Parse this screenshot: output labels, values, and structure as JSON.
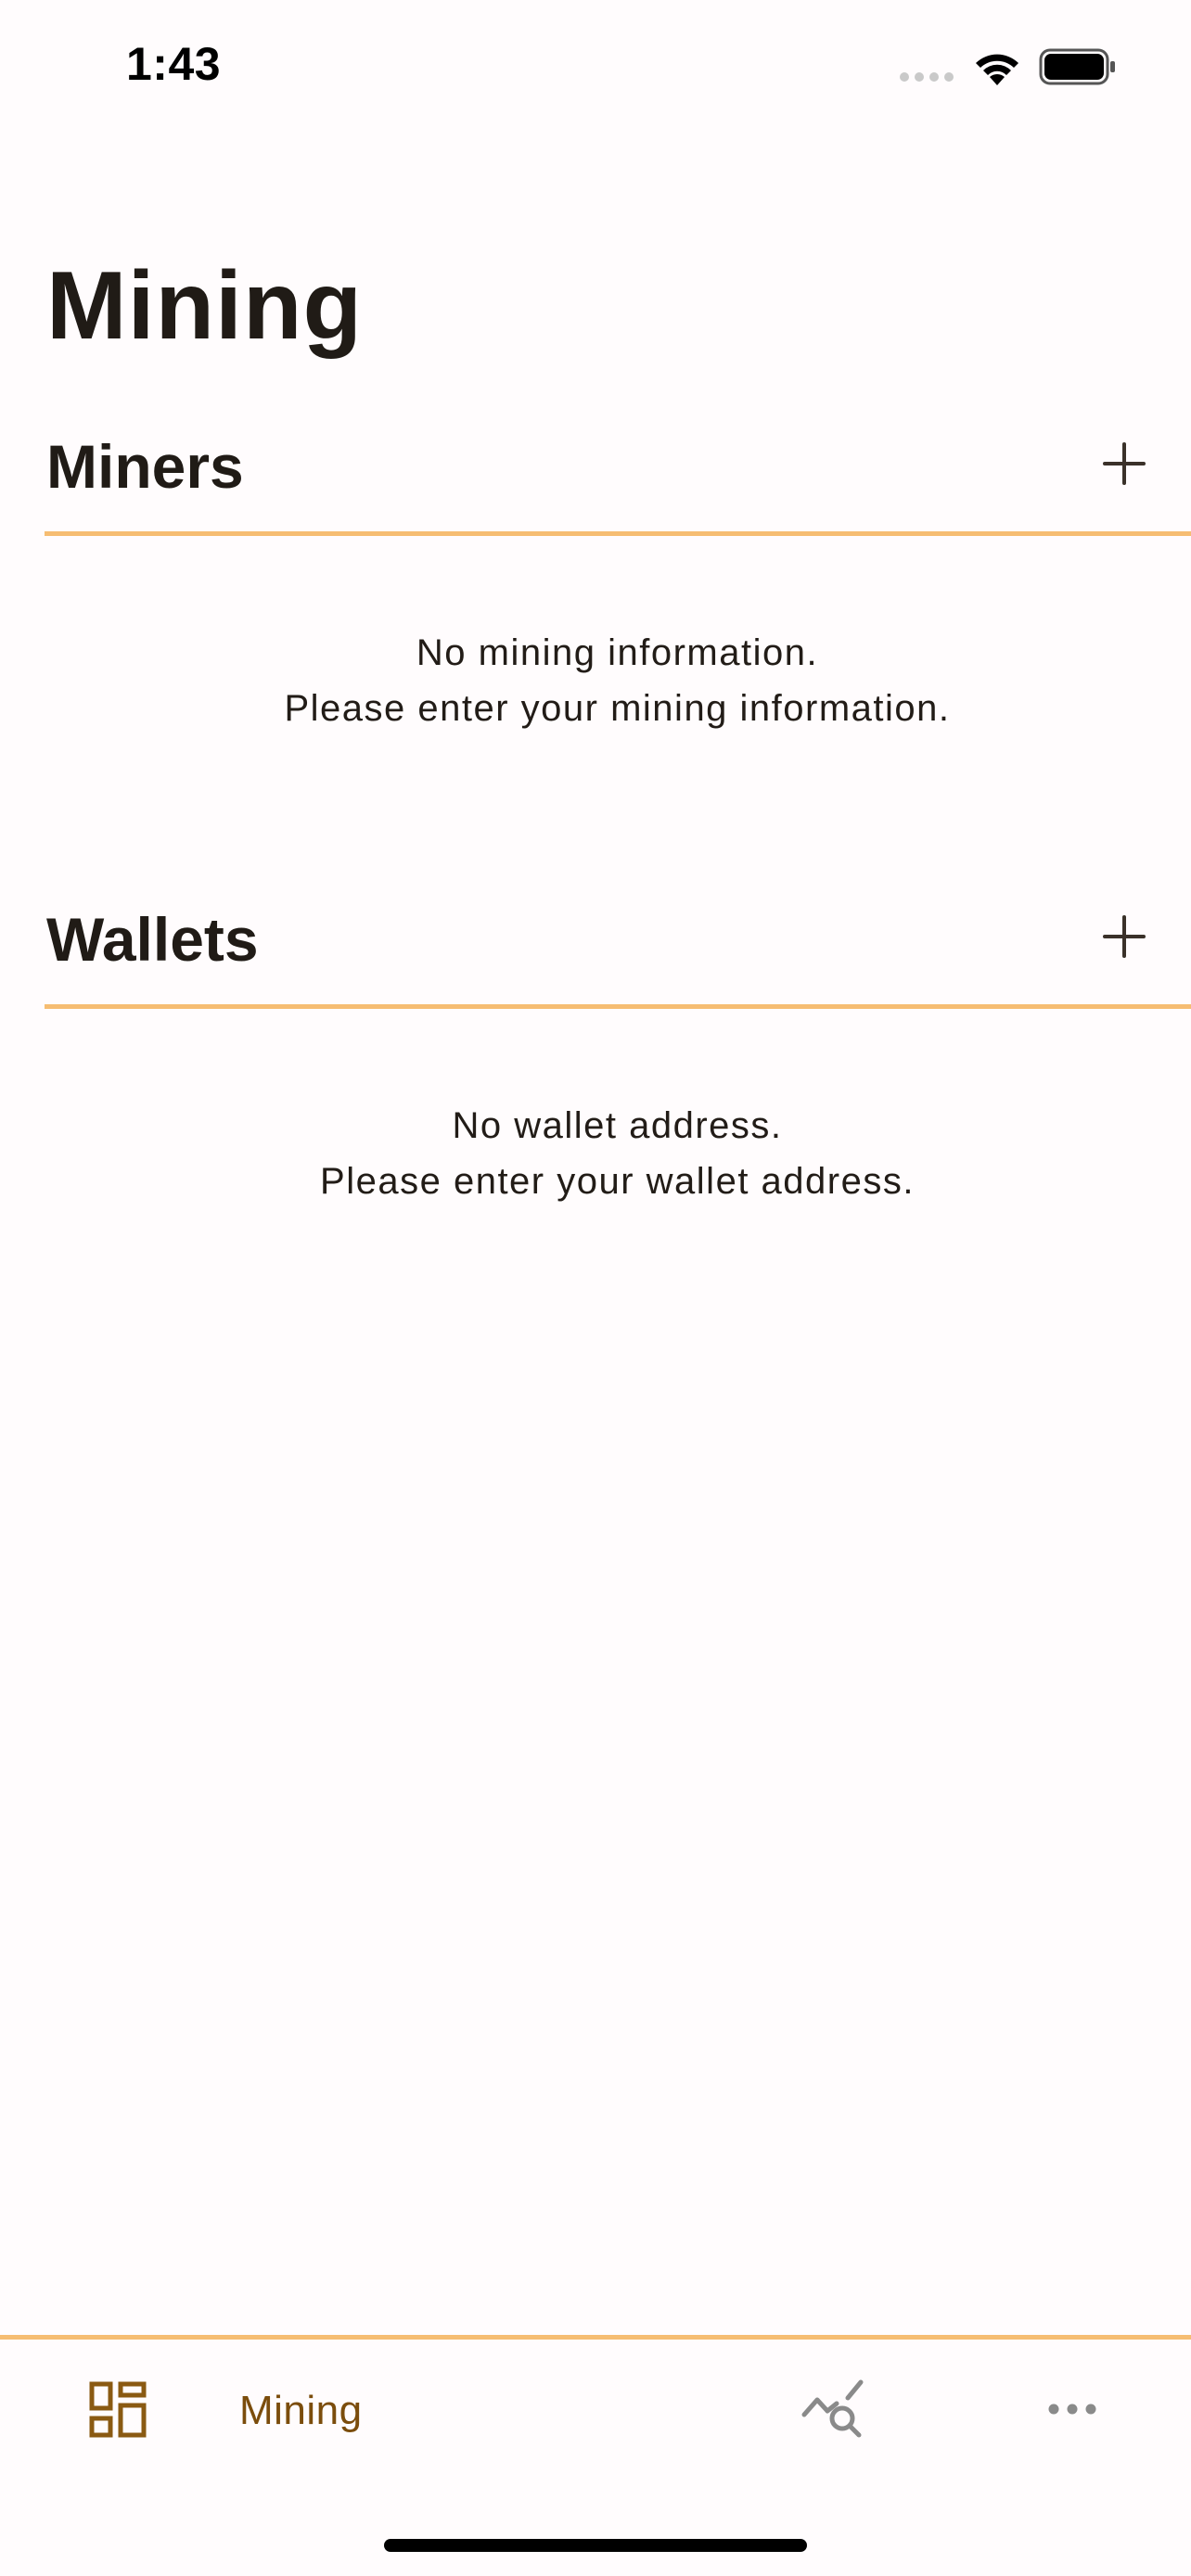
{
  "status_bar": {
    "time": "1:43"
  },
  "page": {
    "title": "Mining"
  },
  "sections": {
    "miners": {
      "title": "Miners",
      "add_icon": "plus-icon",
      "empty_line1": "No mining information.",
      "empty_line2": "Please enter your mining information."
    },
    "wallets": {
      "title": "Wallets",
      "add_icon": "plus-icon",
      "empty_line1": "No wallet address.",
      "empty_line2": "Please enter your wallet address."
    }
  },
  "tab_bar": {
    "tabs": [
      {
        "label": "Mining",
        "icon": "dashboard-grid-icon",
        "selected": true
      },
      {
        "icon": "chart-search-icon",
        "selected": false
      },
      {
        "icon": "more-dots-icon",
        "selected": false
      }
    ]
  },
  "colors": {
    "accent": "#f6bd72",
    "selected_tab": "#7b4d0c",
    "unselected_tab": "#8a8a8a",
    "background": "#fffcfd",
    "text": "#201b16"
  }
}
